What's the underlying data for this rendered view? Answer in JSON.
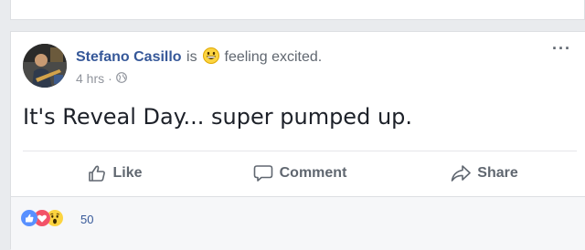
{
  "post": {
    "author": "Stefano Casillo",
    "is_word": "is",
    "feeling": "feeling excited.",
    "time": "4 hrs",
    "dot": "·",
    "text": "It's Reveal Day... super pumped up.",
    "more_label": "···"
  },
  "actions": {
    "like": "Like",
    "comment": "Comment",
    "share": "Share"
  },
  "reactions": {
    "count": "50",
    "types": [
      "like-icon",
      "love-icon",
      "wow-icon"
    ]
  },
  "colors": {
    "author_link": "#365899",
    "like_blue": "#5890ff",
    "love_red": "#f25268",
    "wow_yellow": "#fcd440"
  }
}
